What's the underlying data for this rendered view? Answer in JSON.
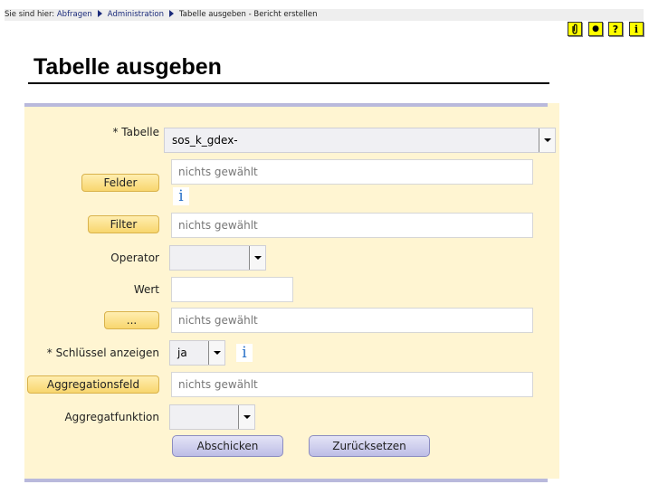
{
  "breadcrumb": {
    "prefix": "Sie sind hier:",
    "items": [
      "Abfragen",
      "Administration"
    ],
    "current": "Tabelle ausgeben - Bericht erstellen"
  },
  "toolbar": {
    "icons": [
      {
        "name": "attachment-icon",
        "glyph": "🖇"
      },
      {
        "name": "bullet-icon",
        "glyph": "●"
      },
      {
        "name": "help-icon",
        "glyph": "?"
      },
      {
        "name": "info-icon",
        "glyph": "i"
      }
    ],
    "icon_color": "#ffff00"
  },
  "page": {
    "title": "Tabelle ausgeben"
  },
  "form": {
    "tabelle_label": "* Tabelle",
    "tabelle_value": "sos_k_gdex-",
    "felder_button": "Felder",
    "felder_value": "nichts gewählt",
    "filter_button": "Filter",
    "filter_value": "nichts gewählt",
    "operator_label": "Operator",
    "operator_value": "",
    "wert_label": "Wert",
    "wert_value": "",
    "more_button": "...",
    "more_value": "nichts gewählt",
    "schluessel_label": "* Schlüssel anzeigen",
    "schluessel_value": "ja",
    "aggregationsfeld_button": "Aggregationsfeld",
    "aggregationsfeld_value": "nichts gewählt",
    "aggregatfunktion_label": "Aggregatfunktion",
    "aggregatfunktion_value": "",
    "info_glyph": "i",
    "submit_label": "Abschicken",
    "reset_label": "Zurücksetzen"
  },
  "colors": {
    "panel_bg": "#fff5d2",
    "panel_border": "#b9b9dc",
    "yellow_button": "#f8d66e",
    "purple_button": "#bdbde6",
    "info_icon": "#2a72c8"
  }
}
